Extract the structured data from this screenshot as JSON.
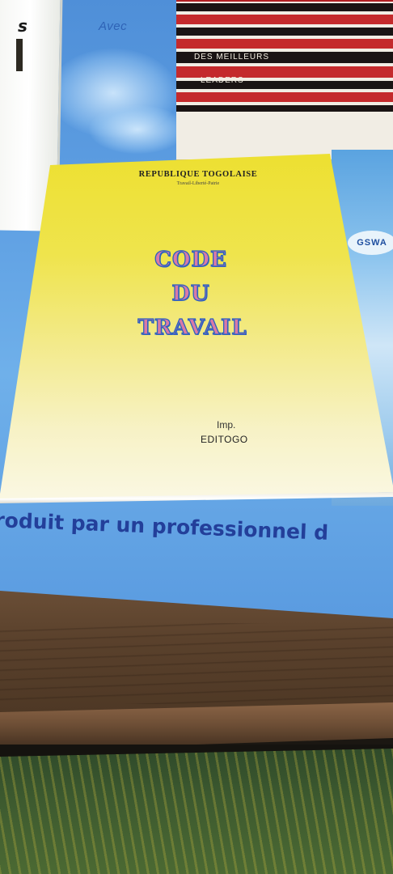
{
  "scene": {
    "mat_top_text": "Avec",
    "mat_bottom_text": "roduit par un professionnel d",
    "white_book_text": "s",
    "red_book": {
      "line1": "DES MEILLEURS",
      "line2": "LEADERS"
    },
    "bottle_logo": "GSWA"
  },
  "book": {
    "republic": "REPUBLIQUE TOGOLAISE",
    "motto": "Travail-Liberté-Patrie",
    "title_line1": "CODE",
    "title_line2": "DU",
    "title_line3": "TRAVAIL",
    "imp_label": "Imp.",
    "publisher": "EDITOGO"
  },
  "colors": {
    "cover_yellow": "#f0e43a",
    "title_pink": "#d97aa6",
    "title_outline_blue": "#2c62c0",
    "mat_blue": "#5fa0e3",
    "mat_text_blue": "#233f9a",
    "wood_brown": "#5a412c"
  }
}
